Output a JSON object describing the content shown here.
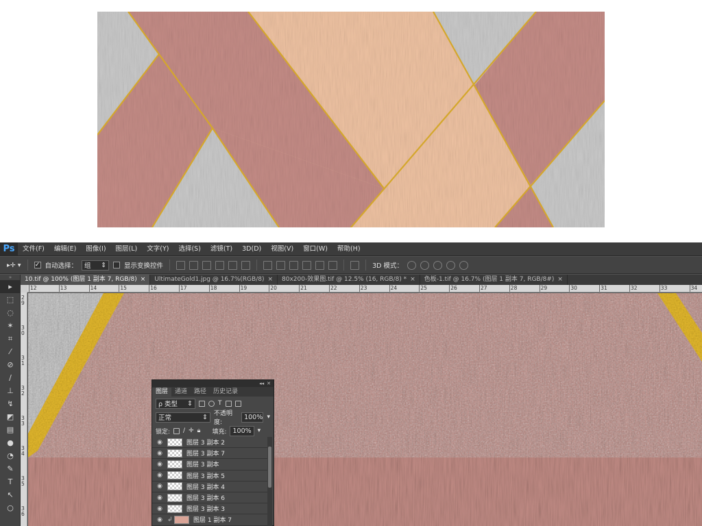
{
  "app": {
    "logo": "Ps"
  },
  "menu": [
    "文件(F)",
    "编辑(E)",
    "图像(I)",
    "图层(L)",
    "文字(Y)",
    "选择(S)",
    "滤镜(T)",
    "3D(D)",
    "视图(V)",
    "窗口(W)",
    "帮助(H)"
  ],
  "options": {
    "auto_select_label": "自动选择：",
    "auto_select_checked": true,
    "auto_select_value": "组",
    "show_transform_label": "显示变换控件",
    "show_transform_checked": false,
    "mode_3d_label": "3D 模式："
  },
  "tabs": [
    {
      "title": "10.tif @ 100% (图层 1 副本 7, RGB/8)",
      "close": "×",
      "active": true
    },
    {
      "title": "UltimateGold1.jpg @ 16.7%(RGB/8)",
      "close": "×",
      "active": false
    },
    {
      "title": "80x200-效果图.tif @ 12.5% (16, RGB/8) *",
      "close": "×",
      "active": false
    },
    {
      "title": "色板-1.tif @ 16.7% (图层 1 副本 7, RGB/8#)",
      "close": "×",
      "active": false
    }
  ],
  "ruler_top": [
    "12",
    "13",
    "14",
    "15",
    "16",
    "17",
    "18",
    "19",
    "20",
    "21",
    "22",
    "23",
    "24",
    "25",
    "26",
    "27",
    "28",
    "29",
    "30",
    "31",
    "32",
    "33",
    "34"
  ],
  "ruler_left": [
    "2\n9",
    "3\n0",
    "3\n1",
    "3\n2",
    "3\n3",
    "3\n4",
    "3\n5",
    "3\n6"
  ],
  "layers_panel": {
    "tabs": [
      "图层",
      "通道",
      "路径",
      "历史记录"
    ],
    "filter_label": "ρ 类型",
    "blend_mode": "正常",
    "opacity_label": "不透明度:",
    "opacity_value": "100%",
    "lock_label": "锁定:",
    "fill_label": "填充:",
    "fill_value": "100%",
    "layers": [
      {
        "name": "图层 3 副本 2"
      },
      {
        "name": "图层 3 副本 7"
      },
      {
        "name": "图层 3 副本"
      },
      {
        "name": "图层 3 副本 5"
      },
      {
        "name": "图层 3 副本 4"
      },
      {
        "name": "图层 3 副本 6"
      },
      {
        "name": "图层 3 副本 3"
      },
      {
        "name": "图层 1 副本 7"
      }
    ]
  },
  "colors": {
    "rose": "#c48c86",
    "peach": "#eec2a2",
    "grey": "#c9c9c9",
    "gold": "#d4a72c",
    "canvas_rose": "#b67d76"
  }
}
